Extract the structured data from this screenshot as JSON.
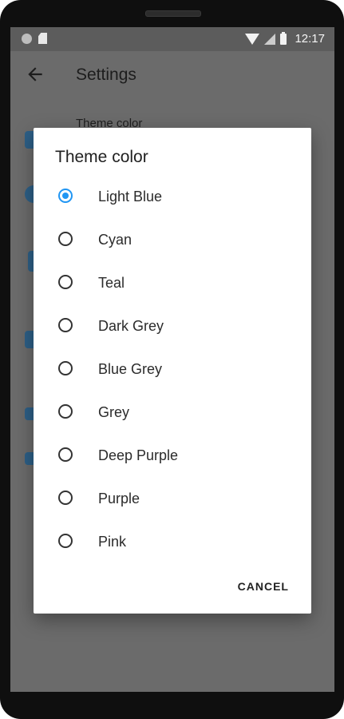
{
  "status_bar": {
    "time": "12:17",
    "icons": [
      "notification-dot-icon",
      "sd-card-icon",
      "wifi-icon",
      "signal-icon",
      "battery-icon"
    ]
  },
  "toolbar": {
    "title": "Settings",
    "back_icon": "arrow-back-icon"
  },
  "background": {
    "first_item_label": "Theme color"
  },
  "dialog": {
    "title": "Theme color",
    "selected_index": 0,
    "accent_color": "#2196f3",
    "options": [
      {
        "label": "Light Blue",
        "selected": true
      },
      {
        "label": "Cyan",
        "selected": false
      },
      {
        "label": "Teal",
        "selected": false
      },
      {
        "label": "Dark Grey",
        "selected": false
      },
      {
        "label": "Blue Grey",
        "selected": false
      },
      {
        "label": "Grey",
        "selected": false
      },
      {
        "label": "Deep Purple",
        "selected": false
      },
      {
        "label": "Purple",
        "selected": false
      },
      {
        "label": "Pink",
        "selected": false
      }
    ],
    "cancel_label": "CANCEL"
  }
}
